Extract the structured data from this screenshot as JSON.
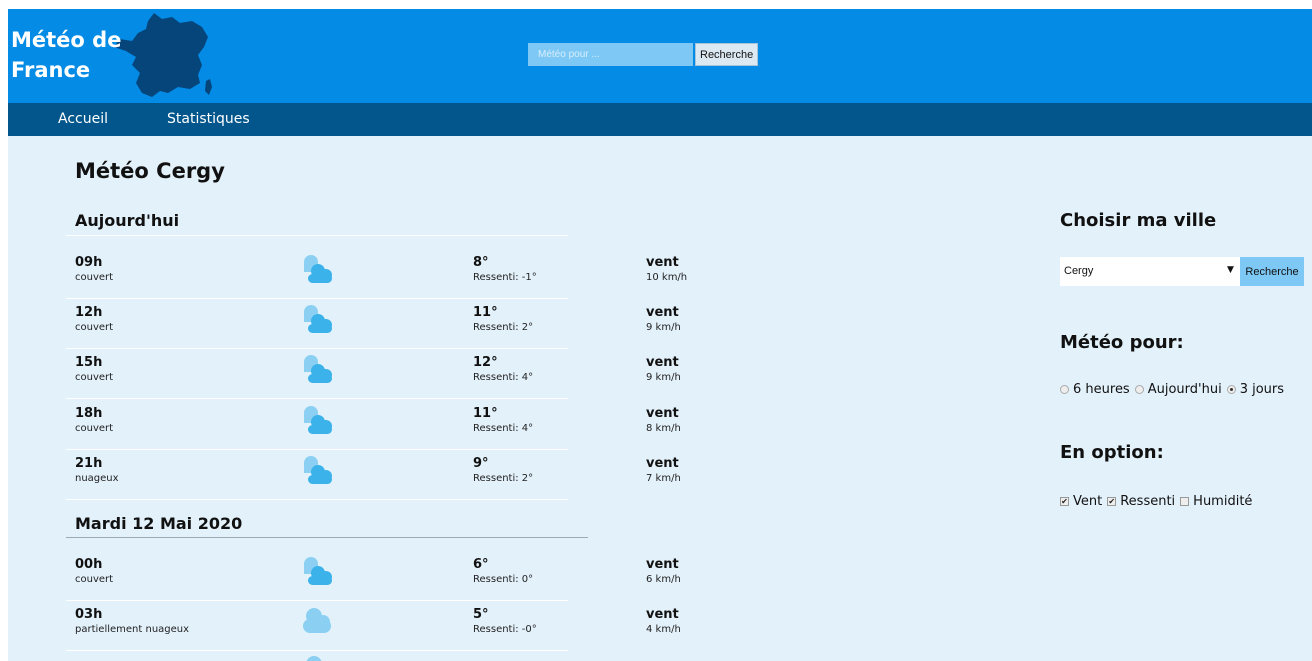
{
  "header": {
    "logo_line1": "Météo de",
    "logo_line2": "France",
    "search_placeholder": "Météo pour ...",
    "search_button": "Recherche"
  },
  "nav": {
    "items": [
      "Accueil",
      "Statistiques"
    ]
  },
  "main": {
    "city_title": "Météo Cergy",
    "sections": [
      {
        "title": "Aujourd'hui",
        "rows": [
          {
            "hour": "09h",
            "condition": "couvert",
            "icon": "cloud-icon",
            "temp": "8°",
            "feel": "Ressenti: -1°",
            "wind_label": "vent",
            "wind": "10 km/h"
          },
          {
            "hour": "12h",
            "condition": "couvert",
            "icon": "cloud-icon",
            "temp": "11°",
            "feel": "Ressenti: 2°",
            "wind_label": "vent",
            "wind": "9 km/h"
          },
          {
            "hour": "15h",
            "condition": "couvert",
            "icon": "cloud-icon",
            "temp": "12°",
            "feel": "Ressenti: 4°",
            "wind_label": "vent",
            "wind": "9 km/h"
          },
          {
            "hour": "18h",
            "condition": "couvert",
            "icon": "cloud-icon",
            "temp": "11°",
            "feel": "Ressenti: 4°",
            "wind_label": "vent",
            "wind": "8 km/h"
          },
          {
            "hour": "21h",
            "condition": "nuageux",
            "icon": "cloud-icon",
            "temp": "9°",
            "feel": "Ressenti: 2°",
            "wind_label": "vent",
            "wind": "7 km/h"
          }
        ]
      },
      {
        "title": "Mardi 12 Mai 2020",
        "rows": [
          {
            "hour": "00h",
            "condition": "couvert",
            "icon": "cloud-icon",
            "temp": "6°",
            "feel": "Ressenti: 0°",
            "wind_label": "vent",
            "wind": "6 km/h"
          },
          {
            "hour": "03h",
            "condition": "partiellement nuageux",
            "icon": "single-cloud-icon",
            "temp": "5°",
            "feel": "Ressenti: -0°",
            "wind_label": "vent",
            "wind": "4 km/h"
          }
        ]
      }
    ]
  },
  "sidebar": {
    "choose_title": "Choisir ma ville",
    "city_selected": "Cergy",
    "choose_button": "Recherche",
    "forecast_title": "Météo pour:",
    "forecast_options": [
      {
        "label": "6 heures",
        "checked": false
      },
      {
        "label": "Aujourd'hui",
        "checked": false
      },
      {
        "label": "3 jours",
        "checked": true
      }
    ],
    "options_title": "En option:",
    "extra_options": [
      {
        "label": "Vent",
        "checked": true
      },
      {
        "label": "Ressenti",
        "checked": true
      },
      {
        "label": "Humidité",
        "checked": false
      }
    ]
  },
  "colors": {
    "header_blue": "#038be6",
    "nav_blue": "#02568c",
    "page_bg": "#e3f1fa",
    "accent_light_blue": "#7dc8f5",
    "icon_blue": "#3bb2ea"
  }
}
